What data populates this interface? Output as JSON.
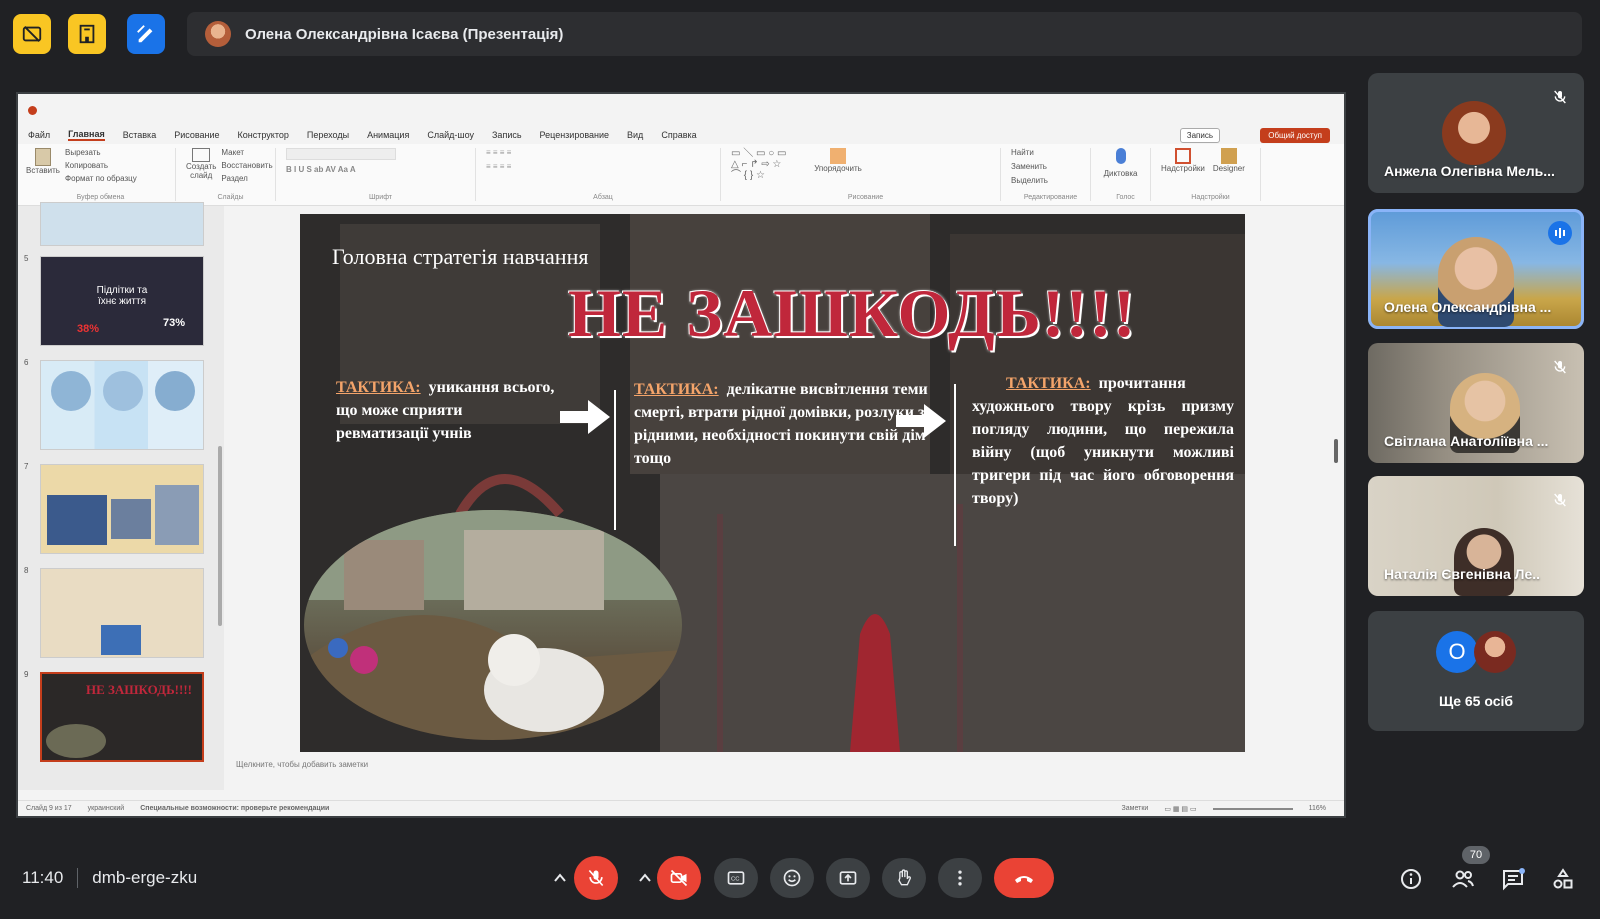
{
  "presenter": {
    "title": "Олена Олександрівна Ісаєва (Презентація)"
  },
  "top_icons": [
    "no-video-icon",
    "building-icon",
    "pen-edit-icon"
  ],
  "powerpoint": {
    "menu": [
      "Файл",
      "Главная",
      "Вставка",
      "Рисование",
      "Конструктор",
      "Переходы",
      "Анимация",
      "Слайд-шоу",
      "Запись",
      "Рецензирование",
      "Вид",
      "Справка"
    ],
    "record_label": "Запись",
    "share_label": "Общий доступ",
    "ribbon": {
      "paste": "Вставить",
      "cut": "Вырезать",
      "copy": "Копировать",
      "format_painter": "Формат по образцу",
      "clipboard": "Буфер обмена",
      "new_slide": "Создать слайд",
      "layout": "Макет",
      "reset": "Восстановить",
      "section": "Раздел",
      "slides": "Слайды",
      "font": "Шрифт",
      "paragraph": "Абзац",
      "arrange": "Упорядочить",
      "drawing": "Рисование",
      "find": "Найти",
      "replace": "Заменить",
      "select": "Выделить",
      "editing": "Редактирование",
      "dictate": "Диктовка",
      "voice": "Голос",
      "addins": "Надстройки",
      "designer": "Designer",
      "addins_group": "Надстройки"
    },
    "thumbnail_numbers": [
      "5",
      "6",
      "7",
      "8",
      "9"
    ],
    "thumb5_title": "Підлітки та їхнє життя",
    "thumb5_stat1": "38%",
    "thumb5_stat2": "73%",
    "thumb9_title": "НЕ ЗАШКОДЬ!!!!",
    "slide": {
      "title": "Головна стратегія навчання",
      "headline": "НЕ ЗАШКОДЬ!!!!",
      "tactic_label": "ТАКТИКА:",
      "tactic1": "уникання всього, що може сприяти ревматизації учнів",
      "tactic2": "делікатне висвітлення теми смерті, втрати рідної домівки, розлуки з рідними, необхідності покинути свій дім тощо",
      "tactic3": "прочитання художнього твору крізь призму погляду людини, що пережила війну (щоб уникнути можливі тригери під час його обговорення твору)"
    },
    "notes_placeholder": "Щелкните, чтобы добавить заметки",
    "status": {
      "slide_count": "Слайд 9 из 17",
      "language": "украинский",
      "accessibility": "Специальные возможности: проверьте рекомендации",
      "notes": "Заметки",
      "zoom": "116%"
    }
  },
  "participants": [
    {
      "name": "Анжела Олегівна Мель...",
      "muted": true,
      "speaking": false
    },
    {
      "name": "Олена Олександрівна ...",
      "muted": false,
      "speaking": true
    },
    {
      "name": "Світлана Анатоліївна ...",
      "muted": true,
      "speaking": false
    },
    {
      "name": "Наталія Євгенівна Ле..",
      "muted": true,
      "speaking": false
    }
  ],
  "more_people": {
    "initial": "О",
    "label": "Ще 65 осіб"
  },
  "meeting": {
    "time": "11:40",
    "code": "dmb-erge-zku",
    "people_count": "70"
  },
  "colors": {
    "background": "#202124",
    "end_call": "#ea4335",
    "accent_blue": "#8ab4f8",
    "slide_headline": "#c0273b",
    "tactic_label": "#f4a46a"
  }
}
